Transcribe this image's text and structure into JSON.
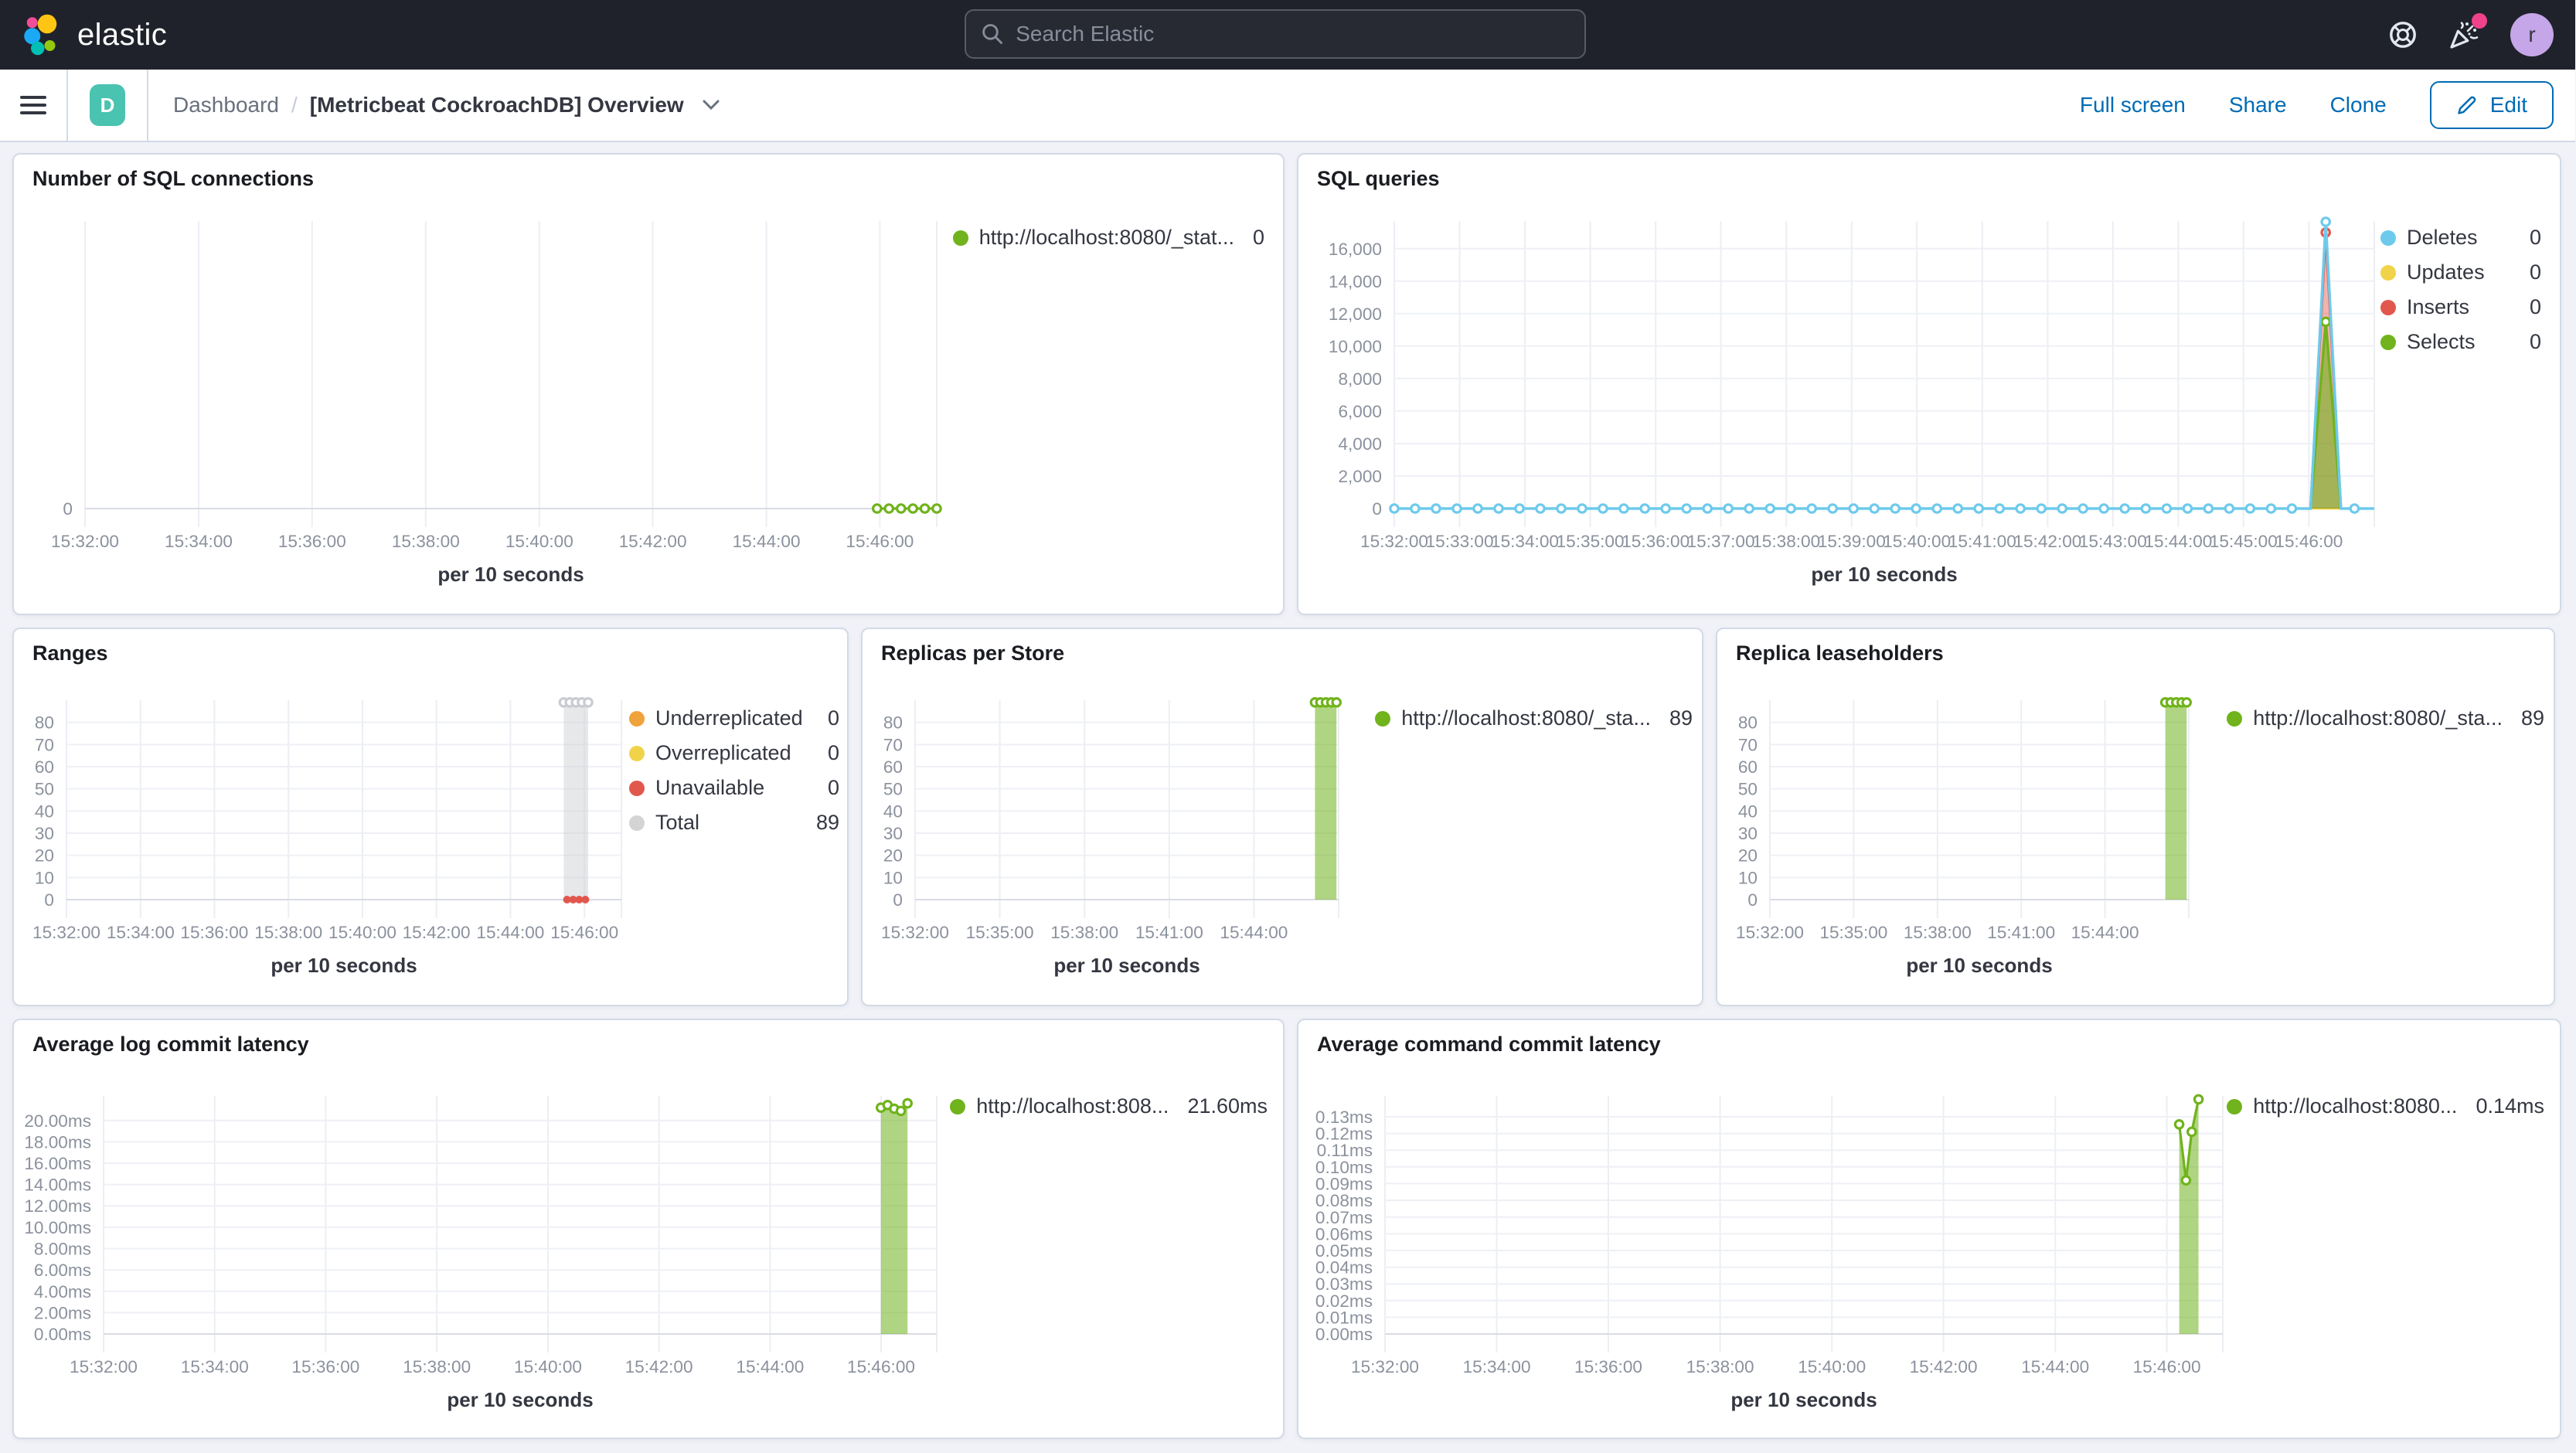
{
  "header": {
    "brand": "elastic",
    "search_placeholder": "Search Elastic",
    "avatar_initial": "r",
    "notification_color": "#f0428c"
  },
  "toolbar": {
    "breadcrumb_root": "Dashboard",
    "breadcrumb_sep": "/",
    "title": "[Metricbeat CockroachDB] Overview",
    "app_badge": "D",
    "actions": {
      "fullscreen": "Full screen",
      "share": "Share",
      "clone": "Clone",
      "edit": "Edit"
    }
  },
  "chart_data": [
    {
      "id": "conn",
      "type": "line",
      "title": "Number of SQL connections",
      "xlabel": "per 10 seconds",
      "x_ticks": [
        "15:32:00",
        "15:34:00",
        "15:36:00",
        "15:38:00",
        "15:40:00",
        "15:42:00",
        "15:44:00",
        "15:46:00"
      ],
      "y_ticks": [
        [
          0,
          "0"
        ]
      ],
      "ymax": 1,
      "x_range": [
        "15:32:00",
        "15:46:40"
      ],
      "legend": [
        {
          "label": "http://localhost:8080/_stat...",
          "value": "0",
          "color": "#70b31c"
        }
      ],
      "series": [
        {
          "name": "http://localhost:8080/_stat...",
          "color": "#70b31c",
          "stroke_width": 1.6,
          "markers": true,
          "points": [
            [
              0.93,
              0
            ],
            [
              0.944,
              0
            ],
            [
              0.958,
              0
            ],
            [
              0.972,
              0
            ],
            [
              0.986,
              0
            ],
            [
              1,
              0
            ]
          ]
        }
      ]
    },
    {
      "id": "queries",
      "type": "area",
      "title": "SQL queries",
      "xlabel": "per 10 seconds",
      "x_ticks": [
        "15:32:00",
        "15:33:00",
        "15:34:00",
        "15:35:00",
        "15:36:00",
        "15:37:00",
        "15:38:00",
        "15:39:00",
        "15:40:00",
        "15:41:00",
        "15:42:00",
        "15:43:00",
        "15:44:00",
        "15:45:00",
        "15:46:00"
      ],
      "y_ticks": [
        [
          0,
          "0"
        ],
        [
          2000,
          "2,000"
        ],
        [
          4000,
          "4,000"
        ],
        [
          6000,
          "6,000"
        ],
        [
          8000,
          "8,000"
        ],
        [
          10000,
          "10,000"
        ],
        [
          12000,
          "12,000"
        ],
        [
          14000,
          "14,000"
        ],
        [
          16000,
          "16,000"
        ]
      ],
      "ymax": 17700,
      "legend": [
        {
          "label": "Deletes",
          "value": "0",
          "color": "#6dcaec"
        },
        {
          "label": "Updates",
          "value": "0",
          "color": "#f1d34a"
        },
        {
          "label": "Inserts",
          "value": "0",
          "color": "#e2574c"
        },
        {
          "label": "Selects",
          "value": "0",
          "color": "#70b31c"
        }
      ],
      "series": [
        {
          "name": "Updates",
          "color": "#f1d34a",
          "stroke_width": 1.4,
          "points": [
            [
              0.935,
              0
            ],
            [
              0.966,
              0
            ]
          ]
        },
        {
          "name": "Inserts",
          "color": "#e2574c",
          "fill_opacity": 0.45,
          "stroke_width": 1.7,
          "points": [
            [
              0.935,
              0
            ],
            [
              0.9505,
              17000
            ],
            [
              0.966,
              0
            ]
          ],
          "marker_points": [
            [
              0.9505,
              17000
            ]
          ]
        },
        {
          "name": "Selects",
          "color": "#70b31c",
          "fill_opacity": 0.6,
          "stroke_width": 1.7,
          "points": [
            [
              0.935,
              0
            ],
            [
              0.9505,
              11500
            ],
            [
              0.966,
              0
            ]
          ],
          "marker_points": [
            [
              0.9505,
              11500
            ]
          ]
        },
        {
          "name": "Deletes",
          "color": "#6dcaec",
          "stroke_width": 1.7,
          "marker_step": 0.0213,
          "points": [
            [
              0,
              0
            ],
            [
              0.935,
              0
            ],
            [
              0.9505,
              17650
            ],
            [
              0.966,
              0
            ],
            [
              1,
              0
            ]
          ],
          "marker_points": [
            [
              0.9505,
              17650
            ]
          ]
        }
      ]
    },
    {
      "id": "ranges",
      "type": "area",
      "title": "Ranges",
      "xlabel": "per 10 seconds",
      "x_ticks": [
        "15:32:00",
        "15:34:00",
        "15:36:00",
        "15:38:00",
        "15:40:00",
        "15:42:00",
        "15:44:00",
        "15:46:00"
      ],
      "y_ticks": [
        [
          0,
          "0"
        ],
        [
          10,
          "10"
        ],
        [
          20,
          "20"
        ],
        [
          30,
          "30"
        ],
        [
          40,
          "40"
        ],
        [
          50,
          "50"
        ],
        [
          60,
          "60"
        ],
        [
          70,
          "70"
        ],
        [
          80,
          "80"
        ]
      ],
      "ymax": 90,
      "legend": [
        {
          "label": "Underreplicated",
          "value": "0",
          "color": "#f0a23b"
        },
        {
          "label": "Overreplicated",
          "value": "0",
          "color": "#f1d34a"
        },
        {
          "label": "Unavailable",
          "value": "0",
          "color": "#e2574c"
        },
        {
          "label": "Total",
          "value": "89",
          "color": "#d4d4d4"
        }
      ],
      "series": [
        {
          "name": "Total",
          "color": "#c9cbd0",
          "fill_opacity": 0.45,
          "stroke_width": 1.4,
          "markers": true,
          "points": [
            [
              0.896,
              89
            ],
            [
              0.907,
              89
            ],
            [
              0.918,
              89
            ],
            [
              0.929,
              89
            ],
            [
              0.94,
              89
            ]
          ]
        },
        {
          "name": "Unavailable",
          "color": "#e2574c",
          "stroke_width": 2,
          "marker_step": 0.011,
          "marker_style": "solid",
          "points": [
            [
              0.896,
              0
            ],
            [
              0.94,
              0
            ]
          ]
        },
        {
          "name": "Underreplicated",
          "color": "#f0a23b",
          "points": []
        },
        {
          "name": "Overreplicated",
          "color": "#f1d34a",
          "points": []
        }
      ]
    },
    {
      "id": "replicas",
      "type": "area",
      "title": "Replicas per Store",
      "xlabel": "per 10 seconds",
      "x_ticks": [
        "15:32:00",
        "15:35:00",
        "15:38:00",
        "15:41:00",
        "15:44:00"
      ],
      "y_ticks": [
        [
          0,
          "0"
        ],
        [
          10,
          "10"
        ],
        [
          20,
          "20"
        ],
        [
          30,
          "30"
        ],
        [
          40,
          "40"
        ],
        [
          50,
          "50"
        ],
        [
          60,
          "60"
        ],
        [
          70,
          "70"
        ],
        [
          80,
          "80"
        ]
      ],
      "ymax": 90,
      "legend": [
        {
          "label": "http://localhost:8080/_sta...",
          "value": "89",
          "color": "#70b31c"
        }
      ],
      "series": [
        {
          "name": "http://localhost:8080/_sta...",
          "color": "#70b31c",
          "fill_opacity": 0.55,
          "stroke_width": 1.6,
          "markers": true,
          "points": [
            [
              0.944,
              89
            ],
            [
              0.957,
              89
            ],
            [
              0.97,
              89
            ],
            [
              0.983,
              89
            ],
            [
              0.995,
              89
            ]
          ]
        }
      ]
    },
    {
      "id": "lease",
      "type": "area",
      "title": "Replica leaseholders",
      "xlabel": "per 10 seconds",
      "x_ticks": [
        "15:32:00",
        "15:35:00",
        "15:38:00",
        "15:41:00",
        "15:44:00"
      ],
      "y_ticks": [
        [
          0,
          "0"
        ],
        [
          10,
          "10"
        ],
        [
          20,
          "20"
        ],
        [
          30,
          "30"
        ],
        [
          40,
          "40"
        ],
        [
          50,
          "50"
        ],
        [
          60,
          "60"
        ],
        [
          70,
          "70"
        ],
        [
          80,
          "80"
        ]
      ],
      "ymax": 90,
      "legend": [
        {
          "label": "http://localhost:8080/_sta...",
          "value": "89",
          "color": "#70b31c"
        }
      ],
      "series": [
        {
          "name": "http://localhost:8080/_sta...",
          "color": "#70b31c",
          "fill_opacity": 0.55,
          "stroke_width": 1.6,
          "markers": true,
          "points": [
            [
              0.944,
              89
            ],
            [
              0.957,
              89
            ],
            [
              0.97,
              89
            ],
            [
              0.983,
              89
            ],
            [
              0.995,
              89
            ]
          ]
        }
      ]
    },
    {
      "id": "loglat",
      "type": "area",
      "title": "Average log commit latency",
      "xlabel": "per 10 seconds",
      "x_ticks": [
        "15:32:00",
        "15:34:00",
        "15:36:00",
        "15:38:00",
        "15:40:00",
        "15:42:00",
        "15:44:00",
        "15:46:00"
      ],
      "y_ticks": [
        [
          0,
          "0.00ms"
        ],
        [
          2,
          "2.00ms"
        ],
        [
          4,
          "4.00ms"
        ],
        [
          6,
          "6.00ms"
        ],
        [
          8,
          "8.00ms"
        ],
        [
          10,
          "10.00ms"
        ],
        [
          12,
          "12.00ms"
        ],
        [
          14,
          "14.00ms"
        ],
        [
          16,
          "16.00ms"
        ],
        [
          18,
          "18.00ms"
        ],
        [
          20,
          "20.00ms"
        ]
      ],
      "ymax": 22.3,
      "legend": [
        {
          "label": "http://localhost:808...",
          "value": "21.60ms",
          "color": "#70b31c"
        }
      ],
      "series": [
        {
          "name": "http://localhost:808...",
          "color": "#70b31c",
          "fill_opacity": 0.55,
          "stroke_width": 1.6,
          "markers": true,
          "points": [
            [
              0.933,
              21.2
            ],
            [
              0.941,
              21.45
            ],
            [
              0.949,
              21.1
            ],
            [
              0.957,
              20.9
            ],
            [
              0.965,
              21.6
            ]
          ]
        }
      ]
    },
    {
      "id": "cmdlat",
      "type": "area",
      "title": "Average command commit latency",
      "xlabel": "per 10 seconds",
      "x_ticks": [
        "15:32:00",
        "15:34:00",
        "15:36:00",
        "15:38:00",
        "15:40:00",
        "15:42:00",
        "15:44:00",
        "15:46:00"
      ],
      "y_ticks": [
        [
          0,
          "0.00ms"
        ],
        [
          0.01,
          "0.01ms"
        ],
        [
          0.02,
          "0.02ms"
        ],
        [
          0.03,
          "0.03ms"
        ],
        [
          0.04,
          "0.04ms"
        ],
        [
          0.05,
          "0.05ms"
        ],
        [
          0.06,
          "0.06ms"
        ],
        [
          0.07,
          "0.07ms"
        ],
        [
          0.08,
          "0.08ms"
        ],
        [
          0.09,
          "0.09ms"
        ],
        [
          0.1,
          "0.10ms"
        ],
        [
          0.11,
          "0.11ms"
        ],
        [
          0.12,
          "0.12ms"
        ],
        [
          0.13,
          "0.13ms"
        ]
      ],
      "ymax": 0.1425,
      "legend": [
        {
          "label": "http://localhost:8080...",
          "value": "0.14ms",
          "color": "#70b31c"
        }
      ],
      "series": [
        {
          "name": "http://localhost:8080...",
          "color": "#70b31c",
          "fill_opacity": 0.55,
          "stroke_width": 1.6,
          "markers": true,
          "points": [
            [
              0.948,
              0.1255
            ],
            [
              0.956,
              0.092
            ],
            [
              0.963,
              0.121
            ],
            [
              0.971,
              0.1405
            ]
          ]
        }
      ]
    }
  ]
}
